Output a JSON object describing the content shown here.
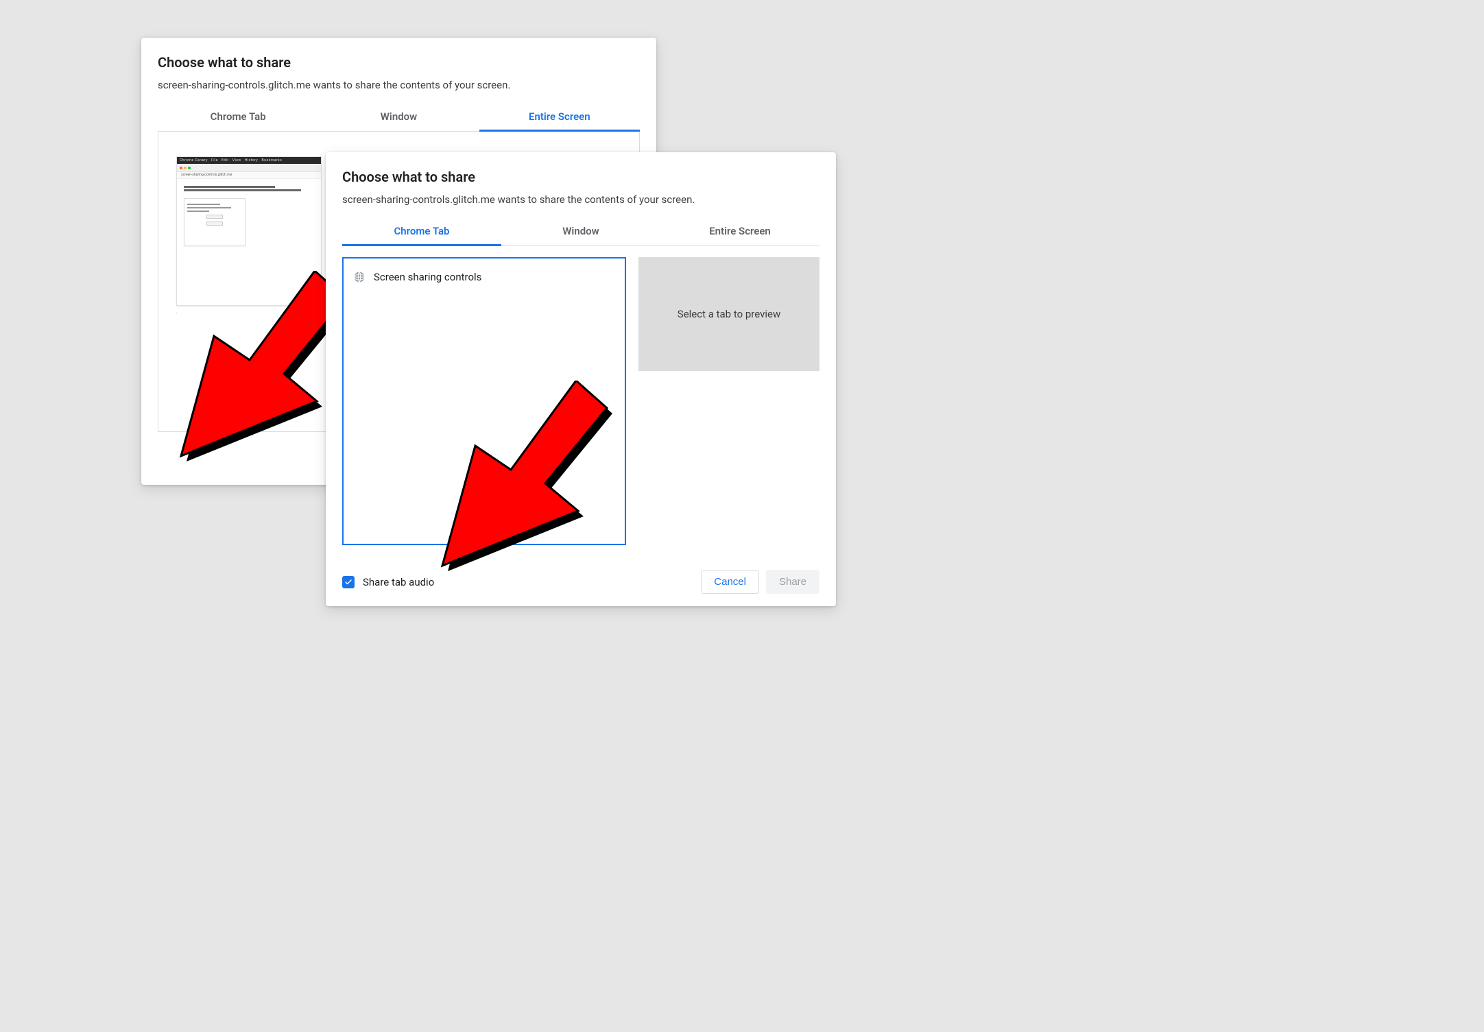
{
  "dialog_back": {
    "title": "Choose what to share",
    "subtext": "screen-sharing-controls.glitch.me wants to share the contents of your screen.",
    "tabs": [
      {
        "label": "Chrome Tab",
        "active": false
      },
      {
        "label": "Window",
        "active": false
      },
      {
        "label": "Entire Screen",
        "active": true
      }
    ]
  },
  "dialog_front": {
    "title": "Choose what to share",
    "subtext": "screen-sharing-controls.glitch.me wants to share the contents of your screen.",
    "tabs": [
      {
        "label": "Chrome Tab",
        "active": true
      },
      {
        "label": "Window",
        "active": false
      },
      {
        "label": "Entire Screen",
        "active": false
      }
    ],
    "tab_items": [
      {
        "label": "Screen sharing controls"
      }
    ],
    "preview_placeholder": "Select a tab to preview",
    "share_audio_label": "Share tab audio",
    "share_audio_checked": true,
    "cancel_label": "Cancel",
    "share_label": "Share"
  },
  "colors": {
    "accent": "#1a73e8"
  }
}
